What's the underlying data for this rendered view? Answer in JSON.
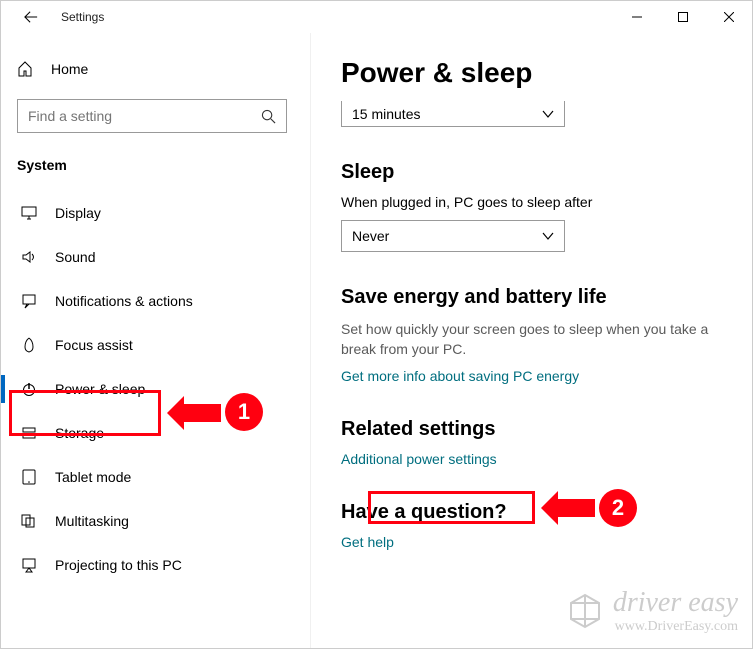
{
  "window": {
    "title": "Settings"
  },
  "sidebar": {
    "home": "Home",
    "search_placeholder": "Find a setting",
    "section": "System",
    "items": [
      {
        "label": "Display"
      },
      {
        "label": "Sound"
      },
      {
        "label": "Notifications & actions"
      },
      {
        "label": "Focus assist"
      },
      {
        "label": "Power & sleep"
      },
      {
        "label": "Storage"
      },
      {
        "label": "Tablet mode"
      },
      {
        "label": "Multitasking"
      },
      {
        "label": "Projecting to this PC"
      }
    ]
  },
  "main": {
    "title": "Power & sleep",
    "screen_dropdown_value": "15 minutes",
    "sleep_heading": "Sleep",
    "sleep_label": "When plugged in, PC goes to sleep after",
    "sleep_dropdown_value": "Never",
    "energy_heading": "Save energy and battery life",
    "energy_desc": "Set how quickly your screen goes to sleep when you take a break from your PC.",
    "energy_link": "Get more info about saving PC energy",
    "related_heading": "Related settings",
    "related_link": "Additional power settings",
    "question_heading": "Have a question?",
    "question_link": "Get help"
  },
  "annotations": {
    "badge1": "1",
    "badge2": "2"
  },
  "watermark": {
    "title": "driver easy",
    "url": "www.DriverEasy.com"
  }
}
